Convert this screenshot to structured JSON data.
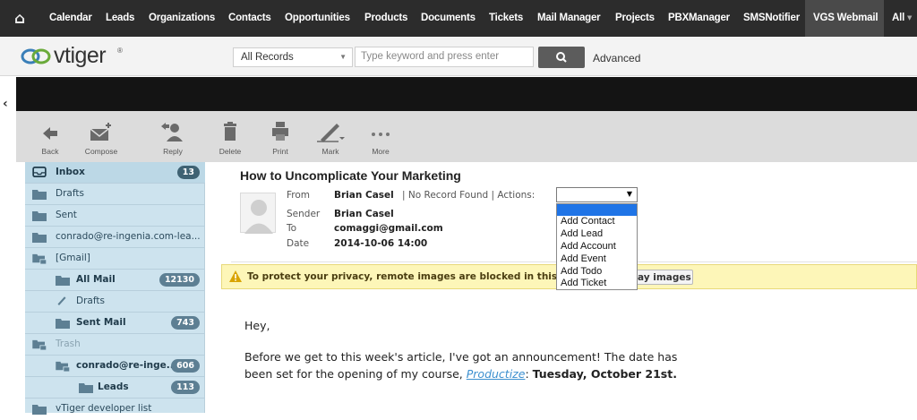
{
  "topnav": {
    "items": [
      "Calendar",
      "Leads",
      "Organizations",
      "Contacts",
      "Opportunities",
      "Products",
      "Documents",
      "Tickets",
      "Mail Manager",
      "Projects",
      "PBXManager",
      "SMSNotifier",
      "VGS Webmail",
      "All"
    ]
  },
  "header": {
    "logo_text": "vtiger",
    "records_select": "All Records",
    "search_placeholder": "Type keyword and press enter",
    "advanced": "Advanced"
  },
  "toolbar": {
    "back": "Back",
    "compose": "Compose",
    "reply": "Reply",
    "delete": "Delete",
    "print": "Print",
    "mark": "Mark",
    "more": "More"
  },
  "sidebar": {
    "folders": [
      {
        "label": "Inbox",
        "count": "13"
      },
      {
        "label": "Drafts",
        "count": ""
      },
      {
        "label": "Sent",
        "count": ""
      },
      {
        "label": "conrado@re-ingenia.com-lea...",
        "count": ""
      },
      {
        "label": "[Gmail]",
        "count": ""
      },
      {
        "label": "All Mail",
        "count": "12130"
      },
      {
        "label": "Drafts",
        "count": ""
      },
      {
        "label": "Sent Mail",
        "count": "743"
      },
      {
        "label": "Trash",
        "count": ""
      },
      {
        "label": "conrado@re-inge...",
        "count": "606"
      },
      {
        "label": "Leads",
        "count": "113"
      },
      {
        "label": "vTiger developer list",
        "count": ""
      }
    ]
  },
  "mail": {
    "subject": "How to Uncomplicate Your Marketing",
    "from_label": "From",
    "from_value": "Brian Casel",
    "from_extra": "| No Record Found | Actions:",
    "sender_label": "Sender",
    "sender_value": "Brian Casel",
    "to_label": "To",
    "to_value": "comaggi@gmail.com",
    "date_label": "Date",
    "date_value": "2014-10-06 14:00",
    "actions_options": [
      "Add Contact",
      "Add Lead",
      "Add Account",
      "Add Event",
      "Add Todo",
      "Add Ticket"
    ],
    "warning": "To protect your privacy, remote images are blocked in this m",
    "display_images": "ay images",
    "greeting": "Hey,",
    "line1": "Before we get to this week's article, I've got an announcement!  The date has",
    "line2_pre": "been set for the opening of my course, ",
    "line2_link": "Productize",
    "line2_colon": ":  ",
    "line2_bold": "Tuesday, October 21st."
  }
}
